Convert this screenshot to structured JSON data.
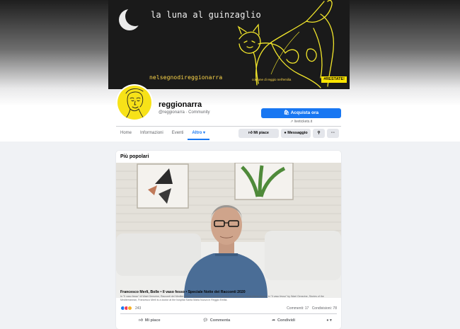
{
  "cover": {
    "title": "la luna al guinzaglio",
    "bottom_text": "nelsegnodireggionarra",
    "small_text": "comune di reggio nell'emilia",
    "badge": "#RESTATE!"
  },
  "page": {
    "name": "reggionarra",
    "handle": "@reggionarra",
    "category": "Community",
    "buy_label": "Acquista ora",
    "link_label": "livetickets.it"
  },
  "nav": {
    "tabs": [
      "Home",
      "Informazioni",
      "Eventi",
      "Altro ▾"
    ],
    "like_label": "Mi piace",
    "message_label": "Messaggio"
  },
  "post": {
    "section_title": "Più popolari",
    "caption": "Francesco Merli, Bolle • Il vaso fesso • Speciale Notte dei Racconti 2020",
    "description": "In \"Il vaso fesso\" di Wael Gensrine, Racconti del Mediterraneo, Francesco Merli è medico presso l'Arcispedale Santa Maria Nuova, in \"Il vaso fesso\" by Wael Gensrine, Stories of the Mediterranean, Francesco Merli is a doctor at the hospital Santa Maria Nuova in Reggio Emilia.",
    "reaction_count": "243",
    "comments": "Commenti: 17",
    "shares": "Condivisioni: 78",
    "actions": {
      "like": "Mi piace",
      "comment": "Commenta",
      "share": "Condividi"
    }
  },
  "colors": {
    "accent": "#1877f2",
    "cover_yellow": "#f7e218",
    "background": "#f0f2f5"
  },
  "icons": [
    "shopping-bag-icon",
    "link-icon",
    "thumbs-up-icon",
    "messenger-icon",
    "search-icon",
    "more-icon",
    "comment-icon",
    "share-icon"
  ]
}
